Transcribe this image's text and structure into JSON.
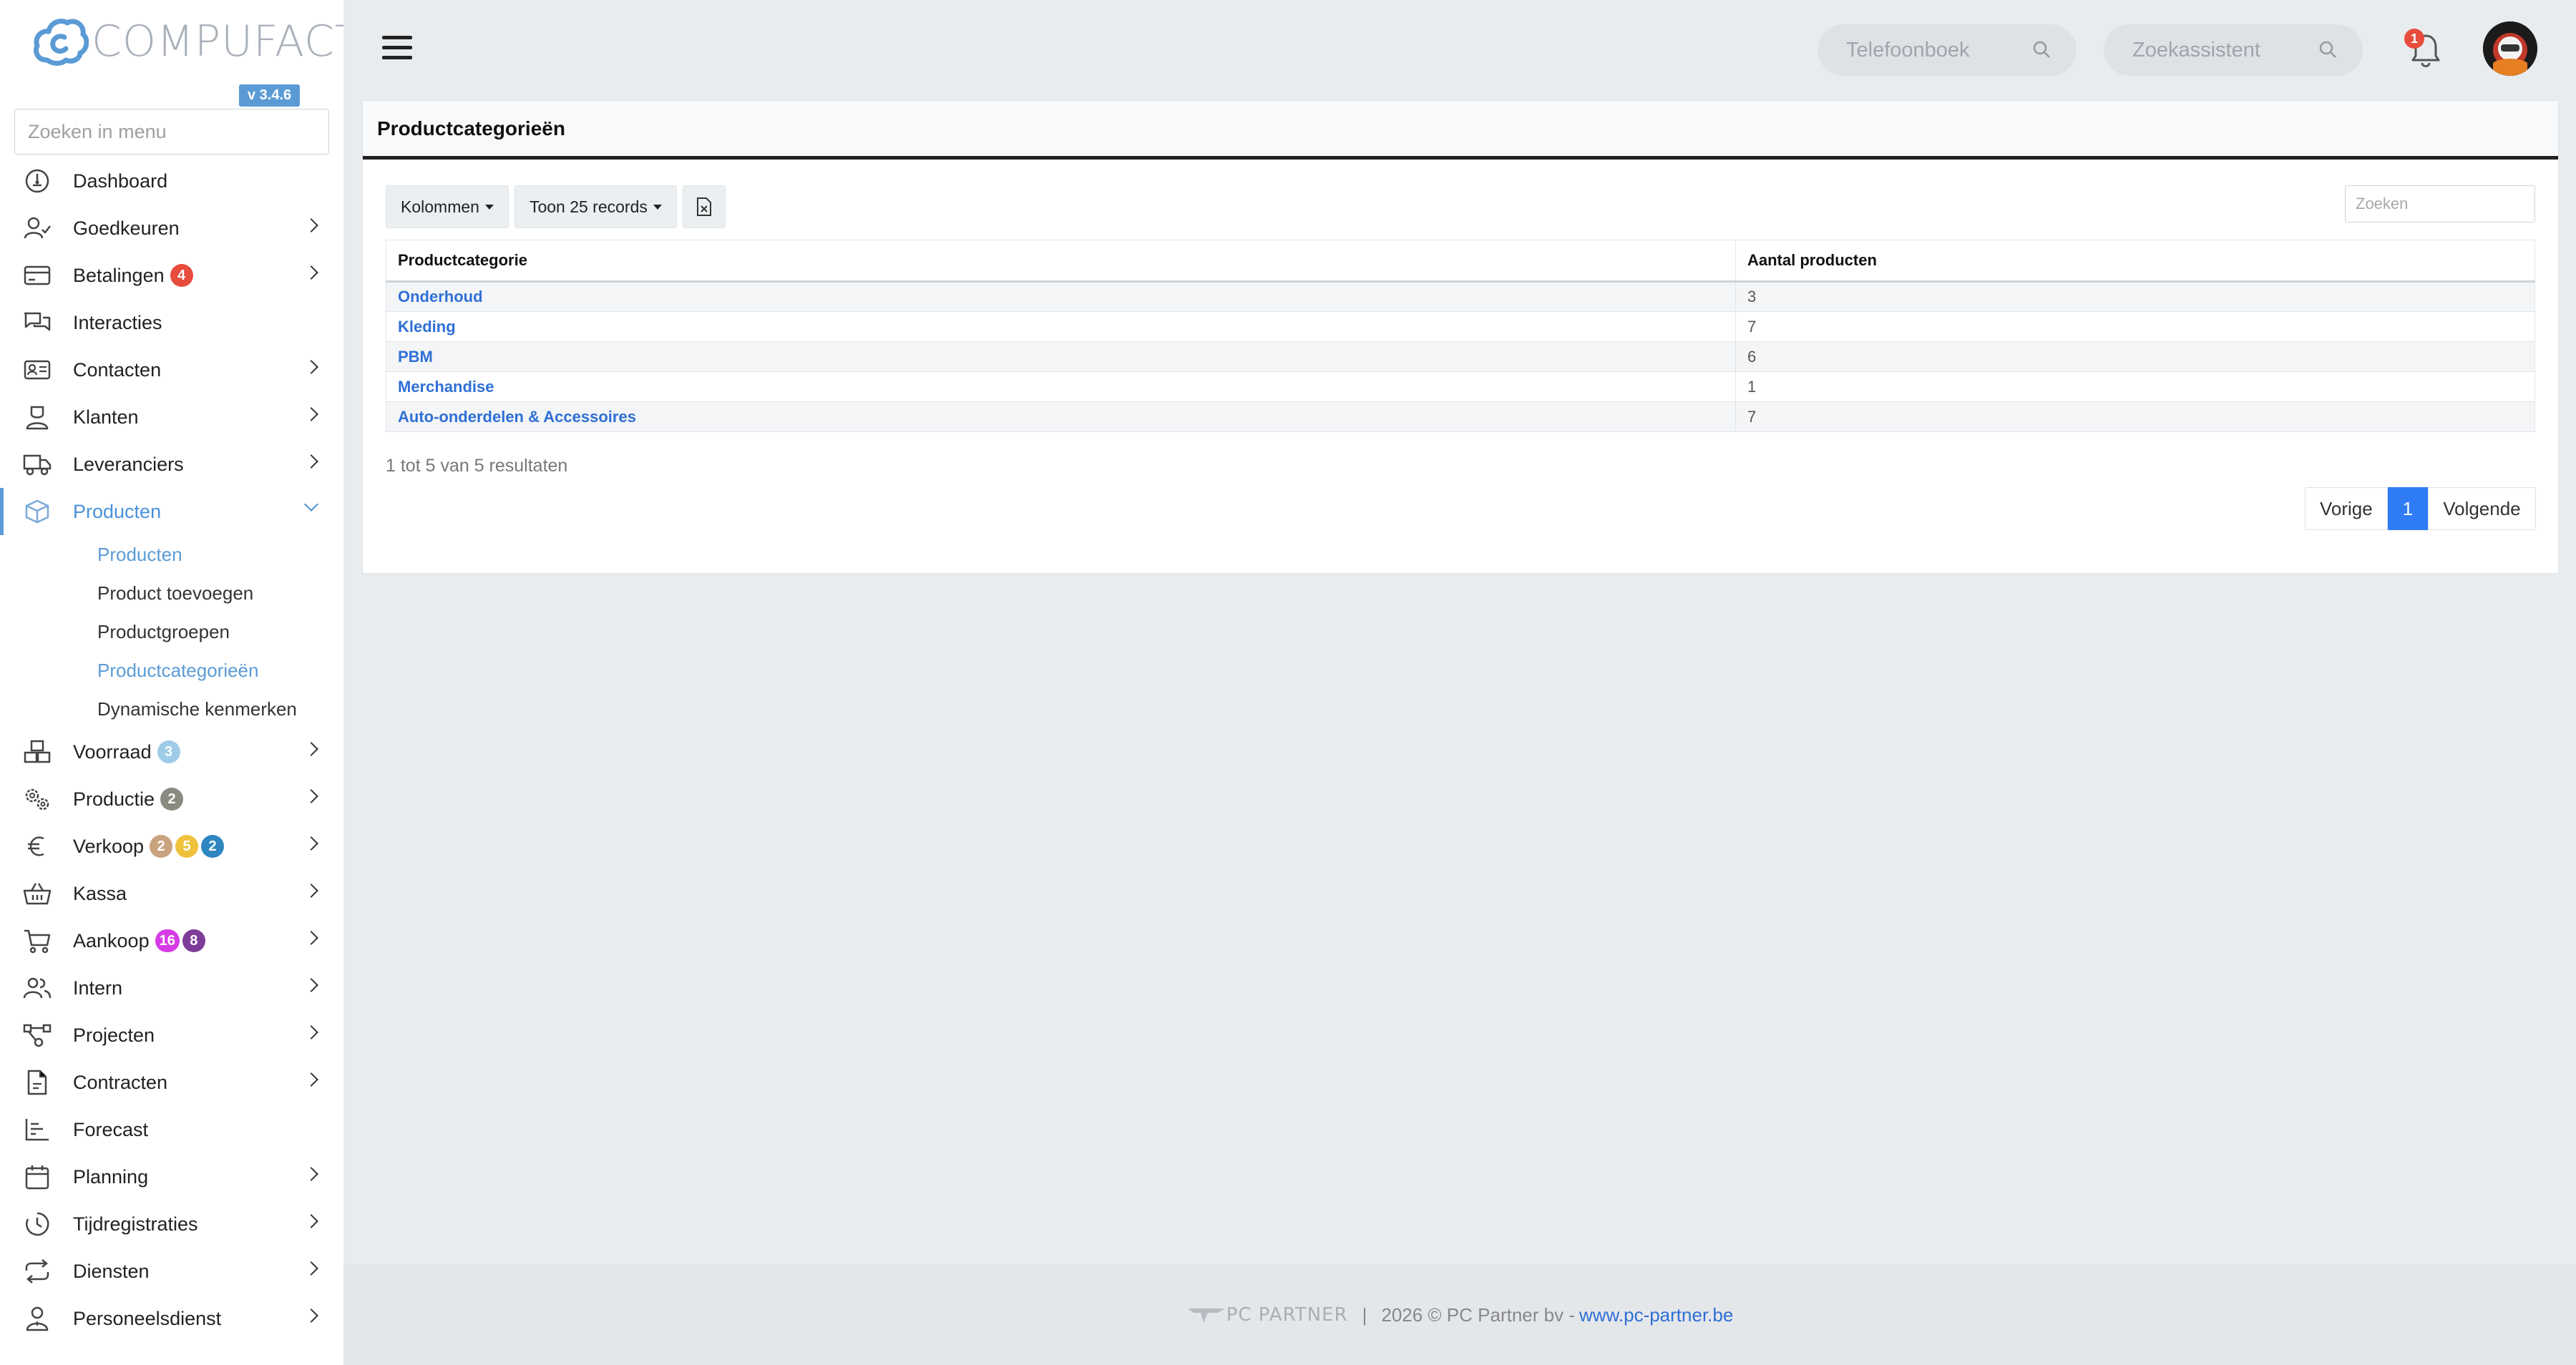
{
  "app": {
    "brand": "COMPUFACT",
    "version": "v 3.4.6"
  },
  "sidebar": {
    "search_placeholder": "Zoeken in menu",
    "items": [
      {
        "label": "Dashboard",
        "icon": "dashboard-icon"
      },
      {
        "label": "Goedkeuren",
        "icon": "user-check-icon"
      },
      {
        "label": "Betalingen",
        "icon": "credit-card-icon",
        "badges": [
          "4"
        ]
      },
      {
        "label": "Interacties",
        "icon": "chat-icon"
      },
      {
        "label": "Contacten",
        "icon": "contact-card-icon"
      },
      {
        "label": "Klanten",
        "icon": "person-icon"
      },
      {
        "label": "Leveranciers",
        "icon": "truck-icon"
      },
      {
        "label": "Producten",
        "icon": "box-icon"
      },
      {
        "label": "Voorraad",
        "icon": "boxes-icon",
        "badges": [
          "3"
        ]
      },
      {
        "label": "Productie",
        "icon": "gears-icon",
        "badges": [
          "2"
        ]
      },
      {
        "label": "Verkoop",
        "icon": "euro-icon",
        "badges": [
          "2",
          "5",
          "2"
        ]
      },
      {
        "label": "Kassa",
        "icon": "basket-icon"
      },
      {
        "label": "Aankoop",
        "icon": "cart-icon",
        "badges": [
          "16",
          "8"
        ]
      },
      {
        "label": "Intern",
        "icon": "users-icon"
      },
      {
        "label": "Projecten",
        "icon": "flow-icon"
      },
      {
        "label": "Contracten",
        "icon": "document-icon"
      },
      {
        "label": "Forecast",
        "icon": "chart-icon"
      },
      {
        "label": "Planning",
        "icon": "calendar-icon"
      },
      {
        "label": "Tijdregistraties",
        "icon": "clock-icon"
      },
      {
        "label": "Diensten",
        "icon": "repeat-icon"
      },
      {
        "label": "Personeelsdienst",
        "icon": "employee-icon"
      }
    ],
    "submenu": [
      {
        "label": "Producten"
      },
      {
        "label": "Product toevoegen"
      },
      {
        "label": "Productgroepen"
      },
      {
        "label": "Productcategorieën"
      },
      {
        "label": "Dynamische kenmerken"
      }
    ],
    "badge_colors": {
      "red": "#e74c3c",
      "lightblue": "#9ecbe8",
      "gray": "#8a8a80",
      "tan": "#c9a27e",
      "yellow": "#f0c23c",
      "blue": "#2e86c1",
      "magenta": "#d63ce6",
      "purple": "#7d3c98"
    }
  },
  "header": {
    "search1_placeholder": "Telefoonboek",
    "search2_placeholder": "Zoekassistent",
    "notification_count": "1"
  },
  "card": {
    "title": "Productcategorieën",
    "columns_button": "Kolommen",
    "records_button": "Toon 25 records",
    "search_placeholder": "Zoeken",
    "table": {
      "headers": [
        "Productcategorie",
        "Aantal producten"
      ],
      "rows": [
        [
          "Onderhoud",
          "3"
        ],
        [
          "Kleding",
          "7"
        ],
        [
          "PBM",
          "6"
        ],
        [
          "Merchandise",
          "1"
        ],
        [
          "Auto-onderdelen & Accessoires",
          "7"
        ]
      ]
    },
    "results_text": "1 tot 5 van 5 resultaten",
    "pager": {
      "prev": "Vorige",
      "current": "1",
      "next": "Volgende"
    }
  },
  "footer": {
    "logo_text": "PC PARTNER",
    "separator": "|",
    "copyright": "2026 © PC Partner bv -",
    "link": "www.pc-partner.be"
  }
}
